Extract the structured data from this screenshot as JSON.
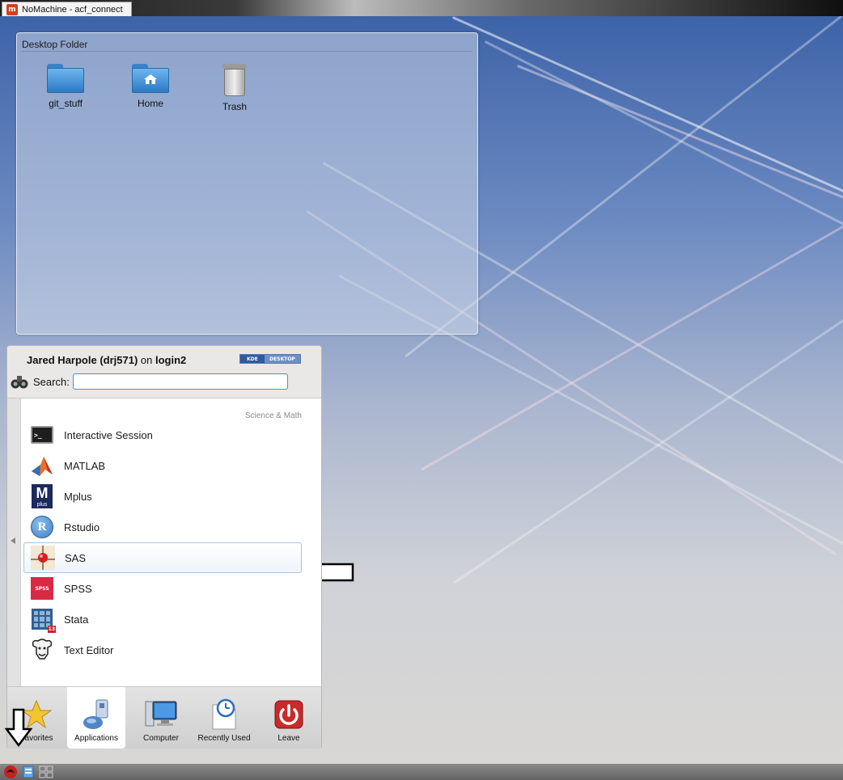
{
  "host_window": {
    "title": "NoMachine - acf_connect",
    "logo_text": "m"
  },
  "folder_view": {
    "title": "Desktop Folder",
    "icons": [
      {
        "label": "git_stuff",
        "icon": "folder-icon"
      },
      {
        "label": "Home",
        "icon": "home-folder-icon"
      },
      {
        "label": "Trash",
        "icon": "trash-icon"
      }
    ]
  },
  "launcher": {
    "user_name": "Jared Harpole (drj571)",
    "user_on": "on",
    "host": "login2",
    "badge_left": "KDE",
    "badge_right": "DESKTOP",
    "search_label": "Search:",
    "search_value": "",
    "category": "Science & Math",
    "apps": [
      {
        "name": "Interactive Session",
        "icon": "terminal-icon"
      },
      {
        "name": "MATLAB",
        "icon": "matlab-icon"
      },
      {
        "name": "Mplus",
        "icon": "mplus-icon"
      },
      {
        "name": "Rstudio",
        "icon": "rstudio-icon"
      },
      {
        "name": "SAS",
        "icon": "sas-icon"
      },
      {
        "name": "SPSS",
        "icon": "spss-icon"
      },
      {
        "name": "Stata",
        "icon": "stata-icon"
      },
      {
        "name": "Text Editor",
        "icon": "text-editor-icon"
      }
    ],
    "highlighted_app": "SAS",
    "tabs": [
      {
        "label": "Favorites",
        "icon": "favorites-star-icon"
      },
      {
        "label": "Applications",
        "icon": "applications-icon",
        "active": true
      },
      {
        "label": "Computer",
        "icon": "computer-icon"
      },
      {
        "label": "Recently Used",
        "icon": "recently-used-clock-icon"
      },
      {
        "label": "Leave",
        "icon": "power-icon"
      }
    ]
  },
  "icon_text": {
    "mplus_big": "M",
    "mplus_small": "plus",
    "rstudio_letter": "R",
    "spss_text": "SPSS",
    "stata_version": "13",
    "terminal_prompt": ">_"
  },
  "colors": {
    "accent_blue": "#4a90d4",
    "leave_red": "#c92a2a",
    "highlight_border": "#a7c4e4"
  }
}
